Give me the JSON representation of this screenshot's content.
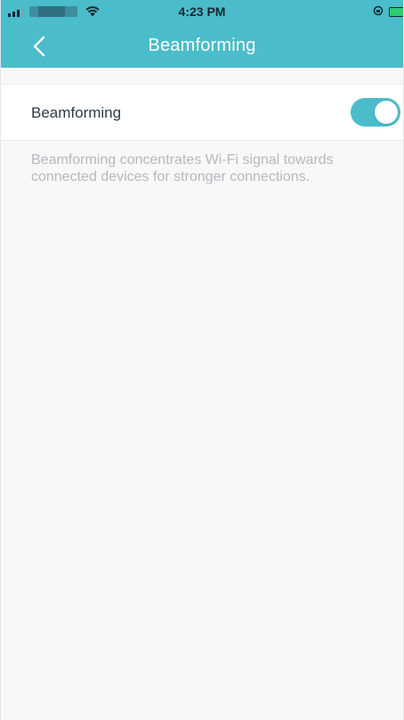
{
  "status_bar": {
    "time": "4:23 PM",
    "signal_icon": "signal-bars-icon",
    "wifi_icon": "wifi-icon",
    "rotation_icon": "rotation-lock-icon",
    "battery_icon": "battery-charging-icon"
  },
  "nav": {
    "back_icon": "chevron-left-icon",
    "title": "Beamforming"
  },
  "setting": {
    "label": "Beamforming",
    "enabled": true
  },
  "description": "Beamforming concentrates Wi-Fi signal towards connected devices for stronger connections.",
  "colors": {
    "accent": "#4bbcc9",
    "background": "#f8f8f9",
    "row_background": "#ffffff",
    "label_text": "#2d3a45",
    "description_text": "#b4b9be"
  }
}
